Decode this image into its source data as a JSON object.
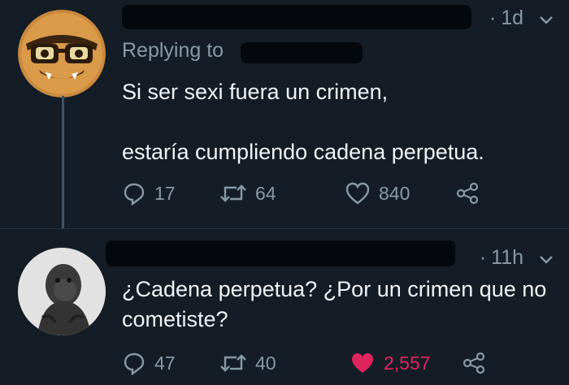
{
  "tweets": [
    {
      "time": "1d",
      "replying_to": "Replying to",
      "text": "Si ser sexi fuera un crimen,\n\nestaría cumpliendo cadena perpetua.",
      "replies": "17",
      "retweets": "64",
      "likes": "840",
      "liked": false
    },
    {
      "time": "11h",
      "text": "¿Cadena perpetua? ¿Por un crimen que no cometiste?",
      "replies": "47",
      "retweets": "40",
      "likes": "2,557",
      "liked": true
    }
  ],
  "colors": {
    "background": "#141d26",
    "secondary_text": "#8899a6",
    "like_active": "#e0245e"
  },
  "icons": [
    "reply-icon",
    "retweet-icon",
    "like-icon",
    "share-icon",
    "chevron-down-icon"
  ]
}
